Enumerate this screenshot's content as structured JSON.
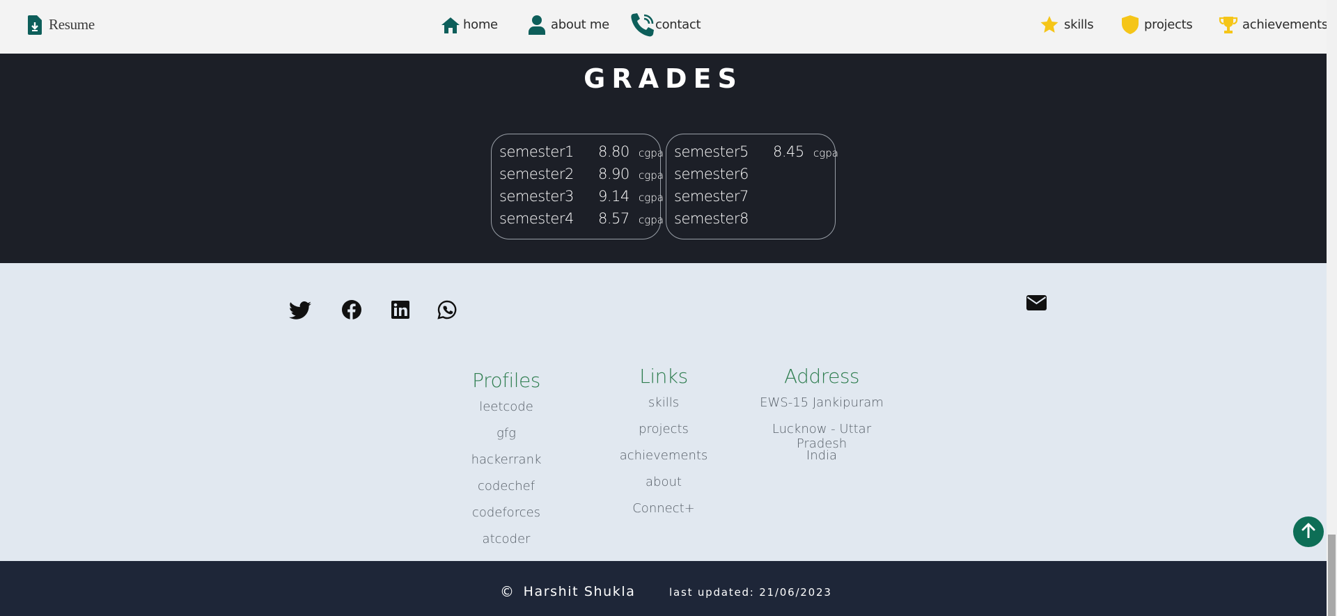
{
  "navbar": {
    "resume_label": "Resume",
    "left_items": [
      {
        "label": "home",
        "icon": "home-icon"
      },
      {
        "label": "about me",
        "icon": "user-icon"
      },
      {
        "label": "contact",
        "icon": "phone-icon"
      }
    ],
    "right_items": [
      {
        "label": "skills",
        "icon": "star-icon"
      },
      {
        "label": "projects",
        "icon": "shield-icon"
      },
      {
        "label": "achievements",
        "icon": "trophy-icon"
      }
    ]
  },
  "grades": {
    "title": "GRADES",
    "card1": [
      {
        "semester": "semester1",
        "value": "8.80",
        "unit": "cgpa"
      },
      {
        "semester": "semester2",
        "value": "8.90",
        "unit": "cgpa"
      },
      {
        "semester": "semester3",
        "value": "9.14",
        "unit": "cgpa"
      },
      {
        "semester": "semester4",
        "value": "8.57",
        "unit": "cgpa"
      }
    ],
    "card2": [
      {
        "semester": "semester5",
        "value": "8.45",
        "unit": "cgpa"
      },
      {
        "semester": "semester6",
        "value": "",
        "unit": ""
      },
      {
        "semester": "semester7",
        "value": "",
        "unit": ""
      },
      {
        "semester": "semester8",
        "value": "",
        "unit": ""
      }
    ]
  },
  "footer": {
    "social_icons": [
      "twitter-icon",
      "facebook-icon",
      "linkedin-icon",
      "whatsapp-icon"
    ],
    "mail_icon": "envelope-icon",
    "profiles": {
      "heading": "Profiles",
      "links": [
        "leetcode",
        "gfg",
        "hackerrank",
        "codechef",
        "codeforces",
        "atcoder"
      ]
    },
    "links": {
      "heading": "Links",
      "links": [
        "skills",
        "projects",
        "achievements",
        "about",
        "Connect+"
      ]
    },
    "address": {
      "heading": "Address",
      "lines": [
        "EWS-15 Jankipuram",
        "Lucknow - Uttar Pradesh",
        "India"
      ]
    }
  },
  "bottom": {
    "copyright_symbol": "©",
    "name": "Harshit Shukla",
    "updated": "last updated: 21/06/2023"
  },
  "colors": {
    "accent": "#0d6e56",
    "nav_icon_teal": "#0d5e5a",
    "nav_icon_gold": "#f5c518",
    "heading_green": "#2e7d4f",
    "grades_bg": "#1c1f27",
    "footer_bg": "#e1e8f0",
    "bottom_bg": "#1e2638"
  }
}
